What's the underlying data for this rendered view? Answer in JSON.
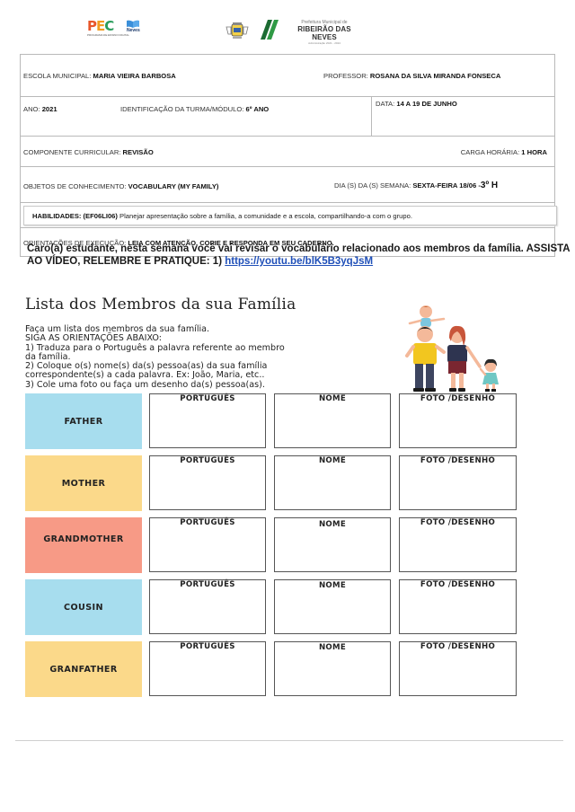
{
  "header": {
    "logo_pec": {
      "letters": [
        "P",
        "E",
        "C"
      ],
      "sub": "PROGRAMA DE ENSINO DIGITAL",
      "neves": "Neves"
    },
    "prefeitura": {
      "top": "Prefeitura Municipal de",
      "main": "RIBEIRÃO DAS NEVES",
      "bottom": "Administração 2021 - 2024"
    },
    "icons": [
      "book-icon",
      "city-crest-icon",
      "green-slash-icon"
    ]
  },
  "form": {
    "school_label": "ESCOLA MUNICIPAL: ",
    "school_value": "MARIA VIEIRA BARBOSA",
    "teacher_label": "PROFESSOR: ",
    "teacher_value": "ROSANA DA SILVA MIRANDA FONSECA",
    "year_label": "ANO: ",
    "year_value": "2021",
    "class_label": "IDENTIFICAÇÃO DA TURMA/MÓDULO: ",
    "class_value": "6º ANO",
    "date_label": "DATA: ",
    "date_value": "14 A 19  DE JUNHO",
    "subject_label": "COMPONENTE CURRICULAR: ",
    "subject_value": "REVISÃO",
    "workload_label": "CARGA HORÁRIA: ",
    "workload_value": "1 HORA",
    "knowledge_label": "OBJETOS DE CONHECIMENTO: ",
    "knowledge_value": "VOCABULARY  (MY FAMILY)",
    "weekday_label": "DIA (S) DA (S) SEMANA: ",
    "weekday_value": "SEXTA-FEIRA 18/06 -",
    "weekday_period": "3º H",
    "skills_label": "HABILIDADES: (EF06LI06)",
    "skills_text": " Planejar apresentação sobre a família, a comunidade e a escola, compartilhando-a  com o grupo.",
    "guidance_label": "ORIENTAÇÕES DE EXECUÇÃO: ",
    "guidance_value": "LEIA COM ATENÇÃO, COPIE E RESPONDA EM SEU CADERNO."
  },
  "intro": {
    "text_line1": "Caro(a)  estudante,  nesta  semana  você  vai revisar o vocabulário relacionado aos membros da família. ASSISTA",
    "text_line2": "AO VÍDEO, RELEMBRE E PRATIQUE: 1)  ",
    "link": "https://youtu.be/blK5B3yqJsM"
  },
  "worksheet": {
    "title": "Lista dos Membros da sua Família",
    "instructions": [
      "Faça um lista dos membros da sua família.",
      "SIGA AS ORIENTAÇÕES ABAIXO:",
      "1) Traduza para o Português a palavra referente ao membro",
      "da família.",
      "2) Coloque o(s) nome(s) da(s)  pessoa(as) da sua família",
      "correspondente(s) a cada palavra. Ex: João, Maria, etc..",
      "3) Cole uma foto ou faça um desenho da(s) pessoa(as)."
    ],
    "illustration": "family-illustration",
    "column_headers": [
      "PORTUGUÊS",
      "NOME",
      "FOTO /DESENHO"
    ],
    "rows": [
      {
        "word": "FATHER",
        "color": "#a7ddee"
      },
      {
        "word": "MOTHER",
        "color": "#fbd98a"
      },
      {
        "word": "GRANDMOTHER",
        "color": "#f79a86"
      },
      {
        "word": "COUSIN",
        "color": "#a7ddee"
      },
      {
        "word": "GRANFATHER",
        "color": "#fbd98a"
      }
    ]
  }
}
